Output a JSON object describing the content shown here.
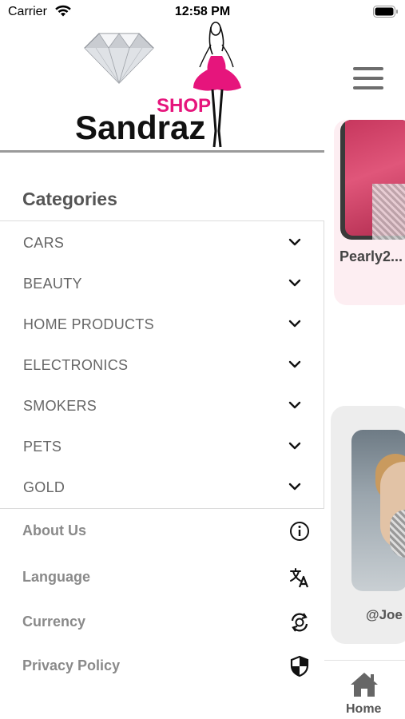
{
  "status_bar": {
    "carrier": "Carrier",
    "time": "12:58 PM"
  },
  "brand": {
    "logo_word_top": "SHOP",
    "logo_word_main": "Sandraz",
    "accent_color": "#e6157c"
  },
  "drawer": {
    "categories_title": "Categories",
    "categories": [
      {
        "label": "CARS"
      },
      {
        "label": "BEAUTY"
      },
      {
        "label": "HOME PRODUCTS"
      },
      {
        "label": "ELECTRONICS"
      },
      {
        "label": "SMOKERS"
      },
      {
        "label": "PETS"
      },
      {
        "label": "GOLD"
      }
    ],
    "menu": [
      {
        "label": "About Us",
        "icon": "info-icon"
      },
      {
        "label": "Language",
        "icon": "translate-icon"
      },
      {
        "label": "Currency",
        "icon": "currency-exchange-icon"
      },
      {
        "label": "Privacy Policy",
        "icon": "shield-icon"
      }
    ]
  },
  "background_page": {
    "card_top_label": "Pearly2...",
    "card_bottom_label": "@Joe",
    "tab_home_label": "Home"
  }
}
